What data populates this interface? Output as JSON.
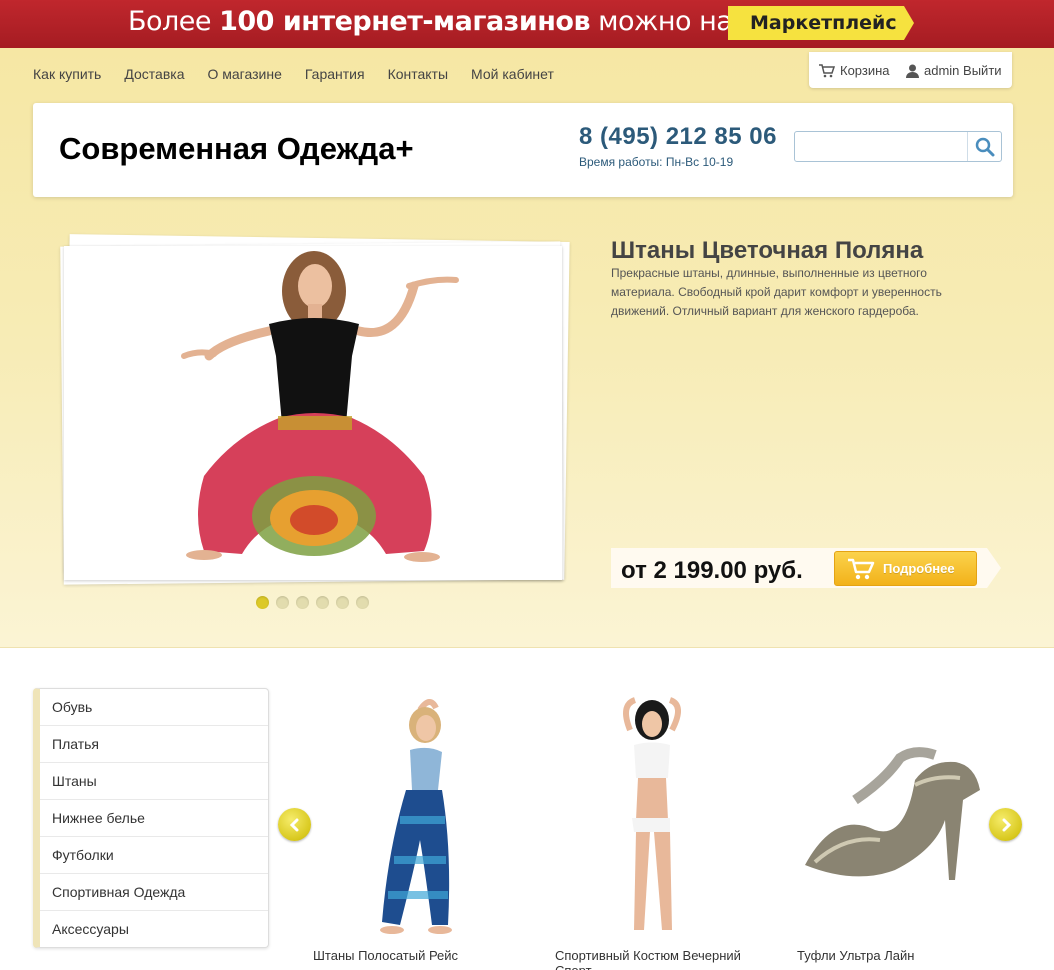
{
  "promo": {
    "text_prefix": "Более ",
    "text_bold": "100 интернет-магазинов",
    "text_suffix": " можно найти в",
    "button_label": "Маркетплейс"
  },
  "nav": {
    "items": [
      "Как купить",
      "Доставка",
      "О магазине",
      "Гарантия",
      "Контакты",
      "Мой кабинет"
    ]
  },
  "user": {
    "cart_label": "Корзина",
    "username": "admin",
    "logout_label": "Выйти"
  },
  "header": {
    "logo": "Современная Одежда+",
    "phone": "8 (495) 212 85 06",
    "hours": "Время работы: Пн-Вс 10-19",
    "search_placeholder": ""
  },
  "hero": {
    "title": "Штаны Цветочная Поляна",
    "description": "Прекрасные штаны, длинные, выполненные из цветного материала. Свободный крой дарит комфорт и уверенность движений. Отличный вариант для женского гардероба.",
    "price": "от 2 199.00 руб.",
    "button_label": "Подробнее",
    "slide_count": 6,
    "active_slide": 1
  },
  "categories": [
    "Обувь",
    "Платья",
    "Штаны",
    "Нижнее белье",
    "Футболки",
    "Спортивная Одежда",
    "Аксессуары"
  ],
  "products": [
    {
      "name": "Штаны Полосатый Рейс"
    },
    {
      "name": "Спортивный Костюм Вечерний Спорт"
    },
    {
      "name": "Туфли Ультра Лайн"
    }
  ],
  "colors": {
    "promo_red": "#b3222a",
    "promo_yellow": "#f6e23f",
    "accent_orange": "#f2b21a",
    "phone_blue": "#2c5a7a"
  }
}
